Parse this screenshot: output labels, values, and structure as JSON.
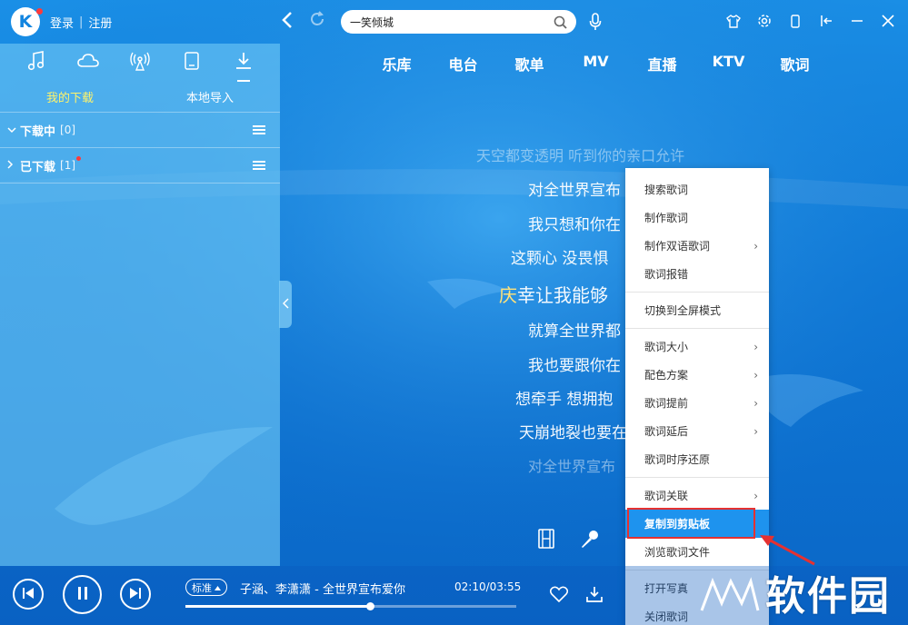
{
  "header": {
    "logo_letter": "K",
    "login": "登录",
    "separator": "|",
    "register": "注册",
    "search_value": "一笑倾城"
  },
  "left_panel": {
    "subtabs": [
      "我的下载",
      "本地导入"
    ],
    "groups": [
      {
        "name": "下载中",
        "count": "[0]"
      },
      {
        "name": "已下载",
        "count": "[1]"
      }
    ]
  },
  "nav_tabs": [
    "乐库",
    "电台",
    "歌单",
    "MV",
    "直播",
    "KTV",
    "歌词"
  ],
  "lyrics": {
    "line1": "天空都变透明 听到你的亲口允许",
    "line2": "对全世界宣布",
    "line3": "我只想和你在",
    "line4": "这颗心 没畏惧",
    "line5_highlight": "庆",
    "line5_rest": "幸让我能够",
    "line6": "就算全世界都",
    "line7": "我也要跟你在",
    "line8": "想牵手 想拥抱",
    "line9": "天崩地裂也要在",
    "line10": "对全世界宣布"
  },
  "context_menu": {
    "items": [
      "搜索歌词",
      "制作歌词",
      "制作双语歌词",
      "歌词报错",
      "切换到全屏模式",
      "歌词大小",
      "配色方案",
      "歌词提前",
      "歌词延后",
      "歌词时序还原",
      "歌词关联",
      "复制到剪贴板",
      "浏览歌词文件",
      "打开写真",
      "关闭歌词"
    ]
  },
  "player": {
    "quality": "标准",
    "song": "子涵、李潇潇 - 全世界宣布爱你",
    "time": "02:10/03:55",
    "progress": 0.56
  },
  "watermark": "软件园",
  "colors": {
    "accent": "#1e93ee",
    "highlight_box": "#e53131",
    "active_tab": "#fff36a",
    "lyric_highlight": "#ffe27a"
  }
}
